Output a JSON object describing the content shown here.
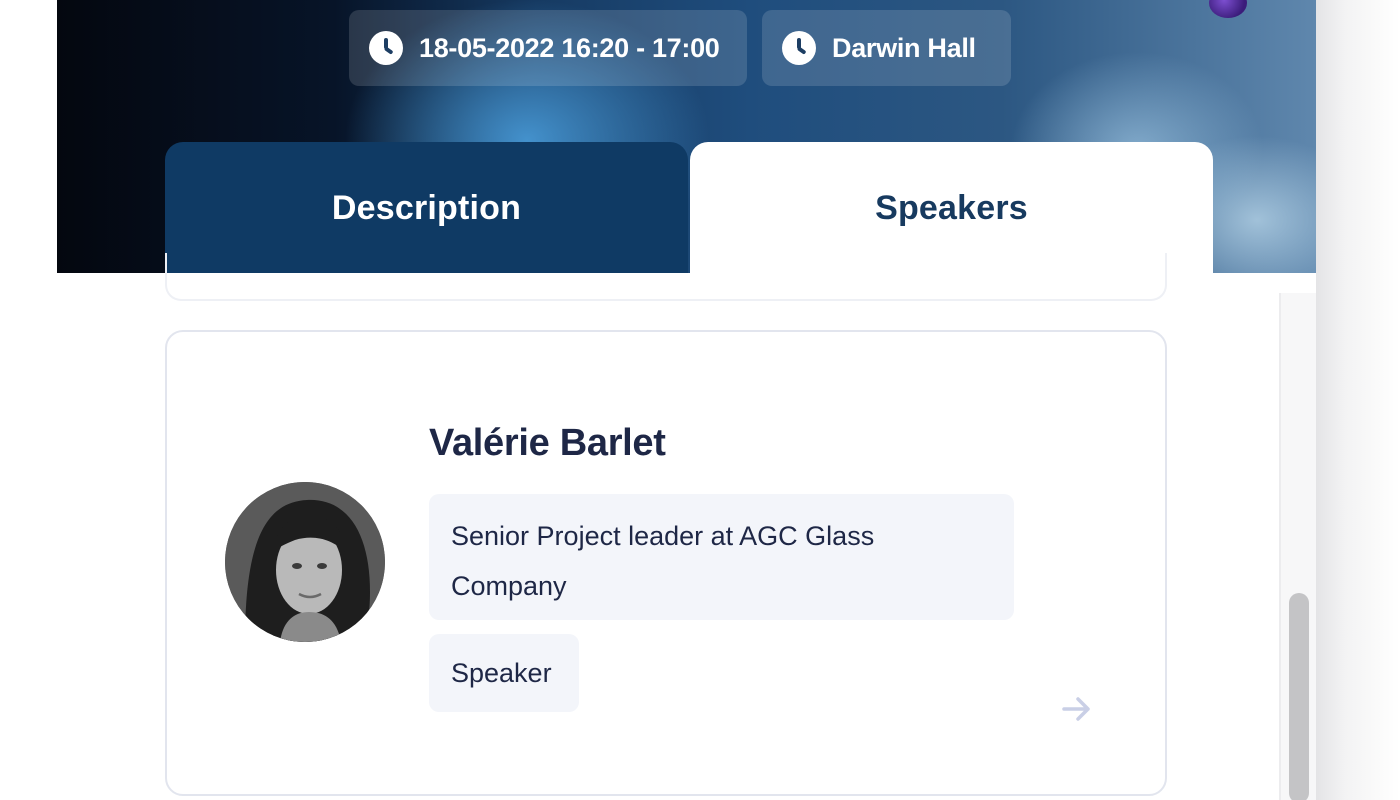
{
  "header": {
    "date_time": "18-05-2022 16:20 - 17:00",
    "location": "Darwin Hall"
  },
  "tabs": [
    {
      "label": "Description",
      "active": false
    },
    {
      "label": "Speakers",
      "active": true
    }
  ],
  "speaker": {
    "name": "Valérie Barlet",
    "title": "Senior Project leader at AGC Glass Company",
    "role": "Speaker"
  },
  "icons": {
    "date_time": "clock-icon",
    "location": "clock-icon",
    "speaker_link": "arrow-right-icon"
  },
  "colors": {
    "tab_active_text": "#173a5f",
    "tab_inactive_bg": "#0f3a64",
    "text_dark": "#1e2746",
    "pill_bg": "#f3f5fa",
    "arrow": "#c9cfe6"
  }
}
